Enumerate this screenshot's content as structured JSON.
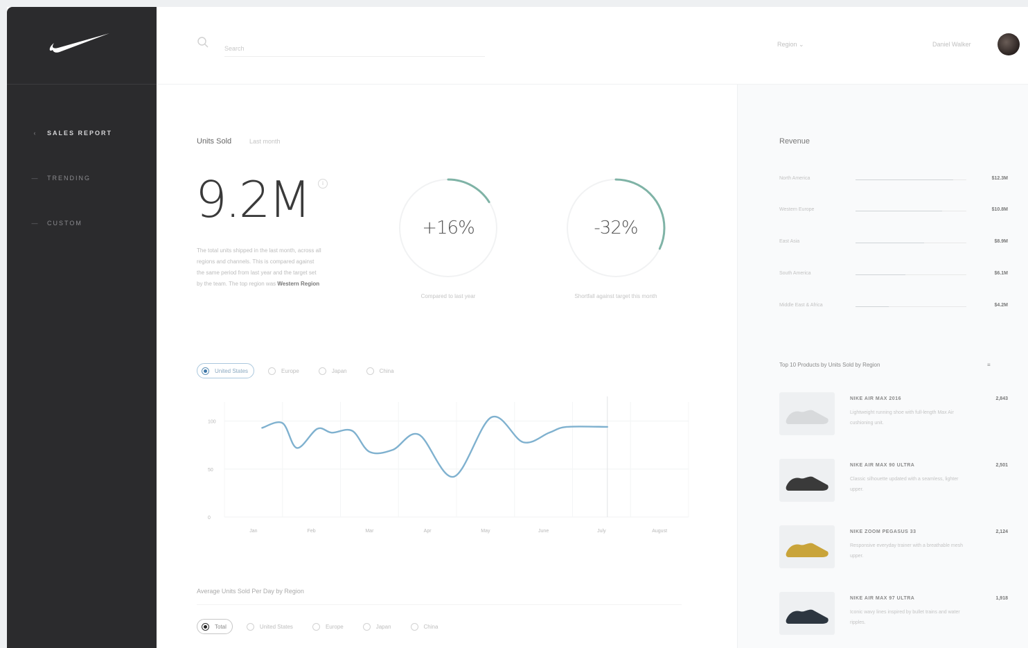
{
  "sidebar": {
    "items": [
      {
        "icon": "back-arrow-icon",
        "glyph": "‹",
        "label": "SALES REPORT",
        "active": true
      },
      {
        "icon": "dash-icon",
        "glyph": "—",
        "label": "TRENDING",
        "active": false
      },
      {
        "icon": "dash-icon",
        "glyph": "—",
        "label": "CUSTOM",
        "active": false
      }
    ]
  },
  "header": {
    "search_placeholder": "Search",
    "select_label": "Region",
    "user_name": "Daniel Walker"
  },
  "main": {
    "section_title": "Units Sold",
    "section_sub": "Last month",
    "big_number": "9.2M",
    "info": "i",
    "description": "The total units shipped in the last month, across all regions and channels. This is compared against the same period from last year and the target set by the team. The top region was",
    "description_highlight": "Western Region",
    "rings": [
      {
        "value": "+16%",
        "label": "Compared to last year",
        "progress": 0.16,
        "color": "#7fb3a6"
      },
      {
        "value": "-32%",
        "label": "Shortfall against target this month",
        "progress": 0.32,
        "color": "#7fb3a6"
      }
    ],
    "chart_tabs": [
      {
        "label": "United States",
        "active": true
      },
      {
        "label": "Europe",
        "active": false
      },
      {
        "label": "Japan",
        "active": false
      },
      {
        "label": "China",
        "active": false
      }
    ],
    "section2_title": "Average Units Sold Per Day by Region",
    "region_tabs": [
      {
        "label": "Total",
        "active": true
      },
      {
        "label": "United States",
        "active": false
      },
      {
        "label": "Europe",
        "active": false
      },
      {
        "label": "Japan",
        "active": false
      },
      {
        "label": "China",
        "active": false
      }
    ]
  },
  "chart_data": {
    "type": "line",
    "x": [
      "Jan",
      "Feb",
      "Mar",
      "Apr",
      "May",
      "June",
      "July",
      "August"
    ],
    "yticks": [
      "100",
      "50",
      "0"
    ],
    "ylim": [
      0,
      120
    ],
    "series": [
      {
        "color": "#7fb1cf",
        "points": [
          [
            0.15,
            93
          ],
          [
            0.5,
            98
          ],
          [
            0.75,
            72
          ],
          [
            1.1,
            92
          ],
          [
            1.35,
            88
          ],
          [
            1.7,
            90
          ],
          [
            2.0,
            68
          ],
          [
            2.4,
            70
          ],
          [
            2.85,
            86
          ],
          [
            3.45,
            42
          ],
          [
            4.1,
            104
          ],
          [
            4.65,
            78
          ],
          [
            5.1,
            88
          ],
          [
            5.4,
            94
          ],
          [
            6.1,
            94
          ]
        ]
      }
    ],
    "current_marker_x": 6.1,
    "grid": true
  },
  "right": {
    "title": "Revenue",
    "bars": [
      {
        "label": "North America",
        "value": "$12.3M",
        "fraction": 0.88
      },
      {
        "label": "Western Europe",
        "value": "$10.8M",
        "fraction": 0.78
      },
      {
        "label": "East Asia",
        "value": "$8.9M",
        "fraction": 0.62
      },
      {
        "label": "South America",
        "value": "$6.1M",
        "fraction": 0.45
      },
      {
        "label": "Middle East & Africa",
        "value": "$4.2M",
        "fraction": 0.3
      }
    ],
    "products_title": "Top 10 Products by Units Sold by Region",
    "products": [
      {
        "name": "NIKE AIR MAX 2016",
        "desc": "Lightweight running shoe with full-length Max Air cushioning unit.",
        "value": "2,843",
        "color": "#d8dadc"
      },
      {
        "name": "NIKE AIR MAX 90 ULTRA",
        "desc": "Classic silhouette updated with a seamless, lighter upper.",
        "value": "2,501",
        "color": "#3a3a3a"
      },
      {
        "name": "NIKE ZOOM PEGASUS 33",
        "desc": "Responsive everyday trainer with a breathable mesh upper.",
        "value": "2,124",
        "color": "#c9a43a"
      },
      {
        "name": "NIKE AIR MAX 97 ULTRA",
        "desc": "Iconic wavy lines inspired by bullet trains and water ripples.",
        "value": "1,918",
        "color": "#2d3640"
      }
    ]
  }
}
